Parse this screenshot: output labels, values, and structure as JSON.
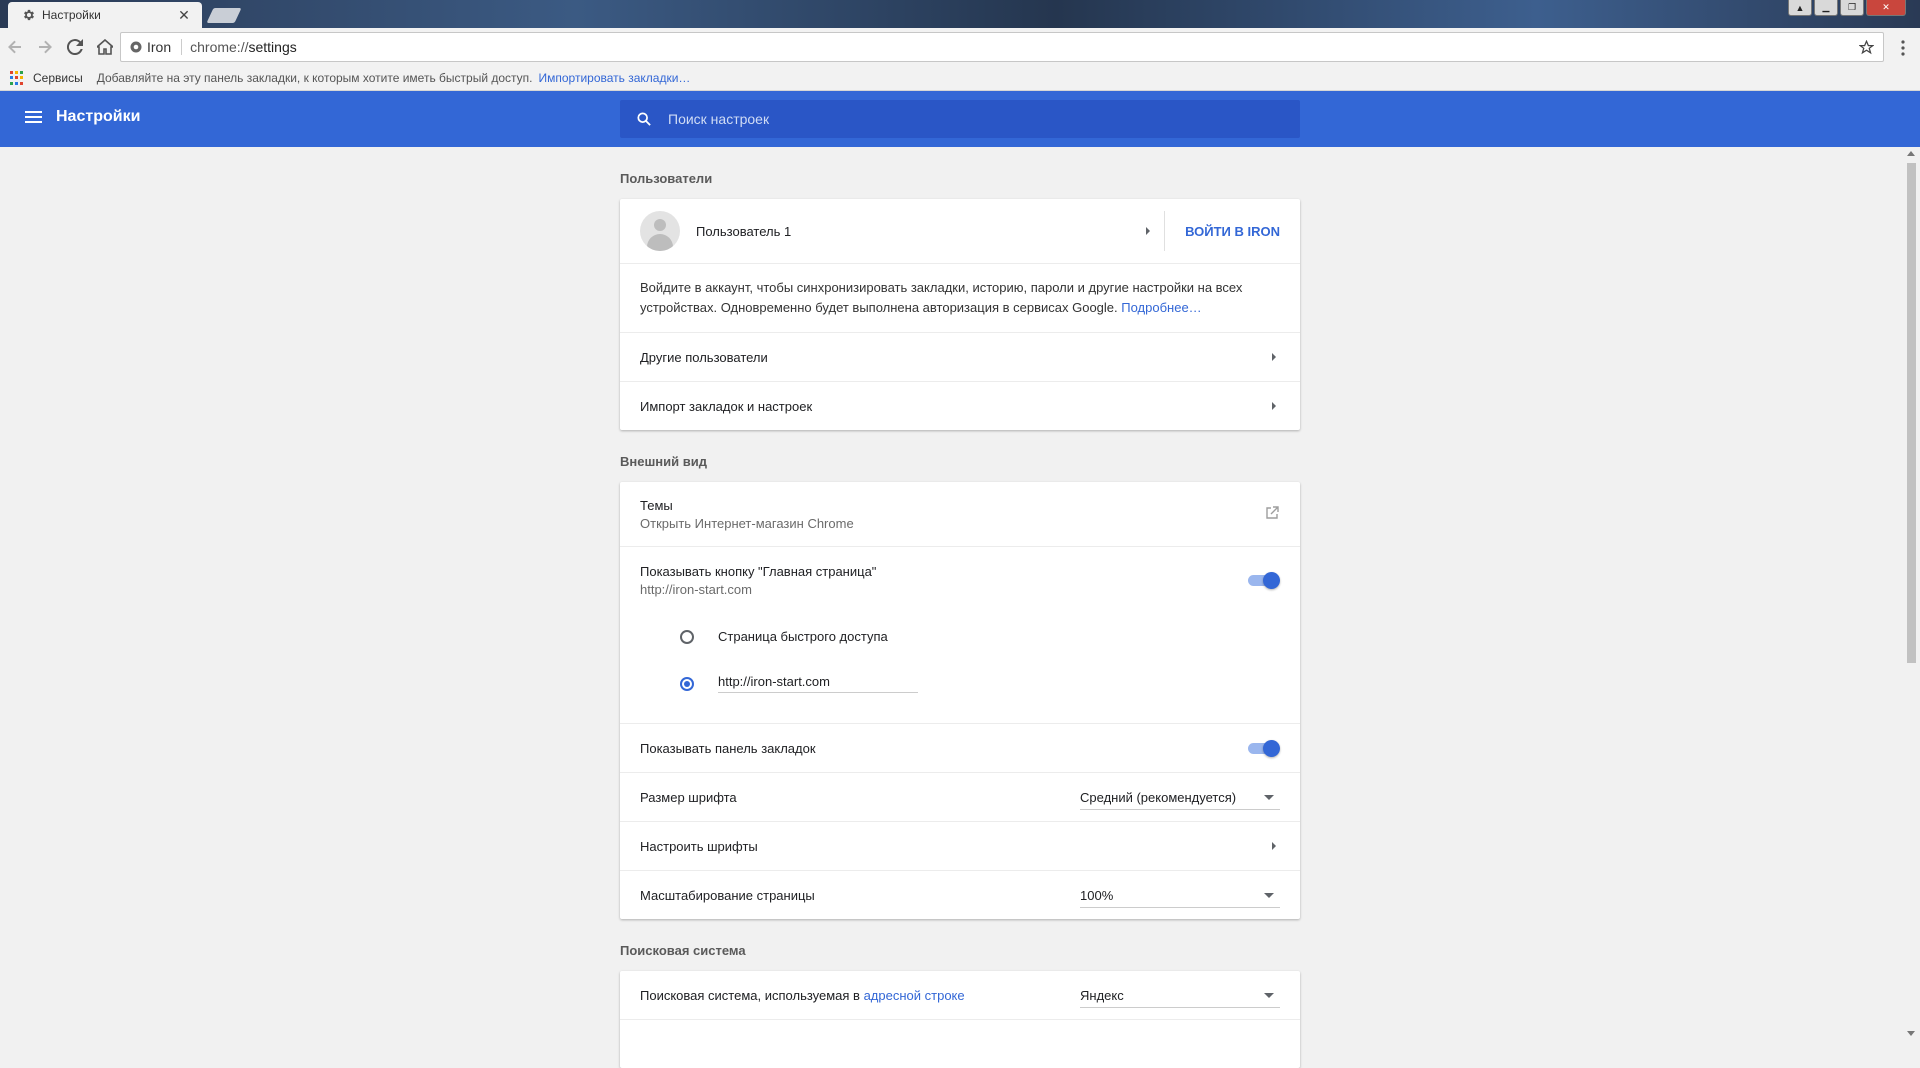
{
  "browser": {
    "tab_title": "Настройки",
    "tab_close": "✕",
    "address_chip": "Iron",
    "url_scheme": "chrome://",
    "url_host": "settings"
  },
  "bookmarks": {
    "apps_label": "Сервисы",
    "hint": "Добавляйте на эту панель закладки, к которым хотите иметь быстрый доступ.",
    "import_link": "Импортировать закладки…"
  },
  "header": {
    "title": "Настройки",
    "search_placeholder": "Поиск настроек"
  },
  "sections": {
    "people": {
      "title": "Пользователи",
      "user_name": "Пользователь 1",
      "signin_button": "ВОЙТИ В IRON",
      "description": "Войдите в аккаунт, чтобы синхронизировать закладки, историю, пароли и другие настройки на всех устройствах. Одновременно будет выполнена авторизация в сервисах Google.",
      "learn_more": "Подробнее…",
      "other_users": "Другие пользователи",
      "import_bookmarks": "Импорт закладок и настроек"
    },
    "appearance": {
      "title": "Внешний вид",
      "themes": "Темы",
      "themes_sub": "Открыть Интернет-магазин Chrome",
      "home_button": "Показывать кнопку \"Главная страница\"",
      "home_button_sub": "http://iron-start.com",
      "radio_ntp": "Страница быстрого доступа",
      "radio_custom_value": "http://iron-start.com",
      "bookmarks_bar": "Показывать панель закладок",
      "font_size": "Размер шрифта",
      "font_size_value": "Средний (рекомендуется)",
      "customize_fonts": "Настроить шрифты",
      "page_zoom": "Масштабирование страницы",
      "page_zoom_value": "100%"
    },
    "search": {
      "title": "Поисковая система",
      "engine_label_prefix": "Поисковая система, используемая в ",
      "engine_label_link": "адресной строке",
      "engine_value": "Яндекс"
    }
  },
  "colors": {
    "accent": "#3367d6",
    "header_bg": "#3367d6",
    "search_bg": "#2a56c6",
    "page_bg": "#f1f1f1"
  }
}
